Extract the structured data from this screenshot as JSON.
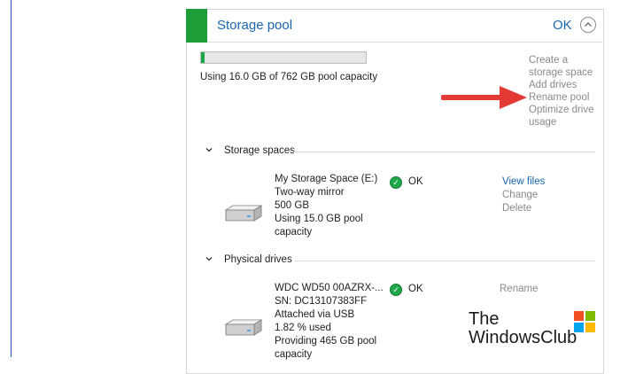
{
  "header": {
    "title": "Storage pool",
    "status": "OK"
  },
  "pool": {
    "usage_fraction": 0.021,
    "capacity_text": "Using 16.0 GB of 762 GB pool capacity"
  },
  "actions": {
    "create": "Create a storage space",
    "add_drives": "Add drives",
    "rename": "Rename pool",
    "optimize": "Optimize drive usage"
  },
  "storage_spaces": {
    "heading": "Storage spaces",
    "item": {
      "name": "My Storage Space (E:)",
      "type": "Two-way mirror",
      "size": "500 GB",
      "usage": "Using 15.0 GB pool capacity",
      "status": "OK",
      "view_files": "View files",
      "change": "Change",
      "delete": "Delete"
    }
  },
  "physical_drives": {
    "heading": "Physical drives",
    "item": {
      "name": "WDC WD50 00AZRX-...",
      "serial": "SN: DC13107383FF",
      "connection": "Attached via USB",
      "used": "1.82 % used",
      "providing": "Providing 465 GB pool capacity",
      "status": "OK",
      "rename": "Rename"
    }
  },
  "watermark": {
    "line1": "The",
    "line2": "WindowsClub"
  },
  "colors": {
    "accent": "#1e9e38",
    "link": "#1a66b0",
    "arrow": "#e53935"
  }
}
